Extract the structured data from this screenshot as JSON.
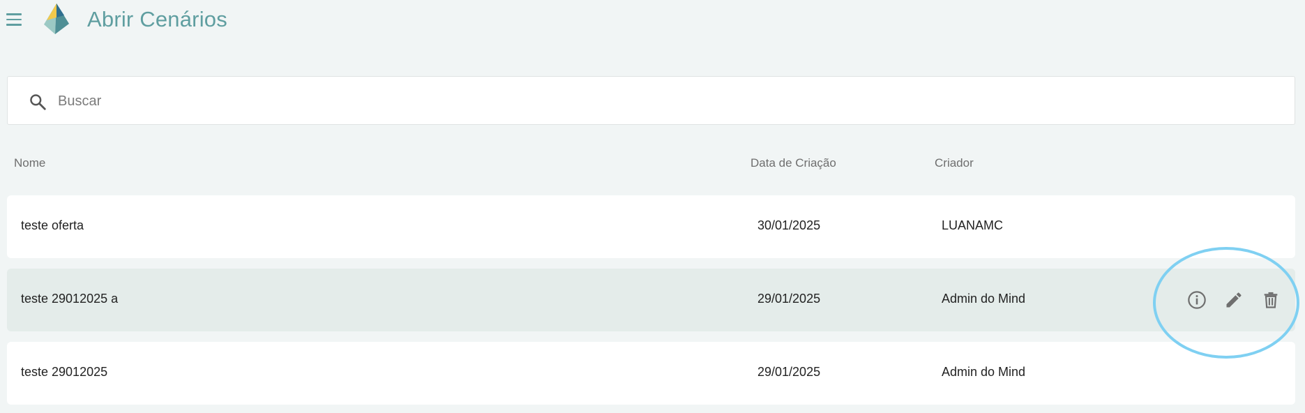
{
  "header": {
    "title": "Abrir Cenários",
    "menu_icon": "hamburger-menu-icon",
    "logo_icon": "pyramid-logo"
  },
  "search": {
    "placeholder": "Buscar",
    "value": "",
    "icon": "search-icon"
  },
  "table": {
    "columns": [
      "Nome",
      "Data de Criação",
      "Criador"
    ],
    "rows": [
      {
        "nome": "teste oferta",
        "data": "30/01/2025",
        "criador": "LUANAMC",
        "selected": false
      },
      {
        "nome": "teste 29012025 a",
        "data": "29/01/2025",
        "criador": "Admin do Mind",
        "selected": true
      },
      {
        "nome": "teste 29012025",
        "data": "29/01/2025",
        "criador": "Admin do Mind",
        "selected": false
      }
    ],
    "row_actions": [
      "info-icon",
      "edit-pencil-icon",
      "delete-trash-icon"
    ]
  },
  "colors": {
    "accent": "#5f9ea0",
    "background": "#f1f5f5",
    "selected_row": "#e4ecea",
    "highlight_ring": "#7fd0f2",
    "icon_gray": "#6f6f6f"
  }
}
